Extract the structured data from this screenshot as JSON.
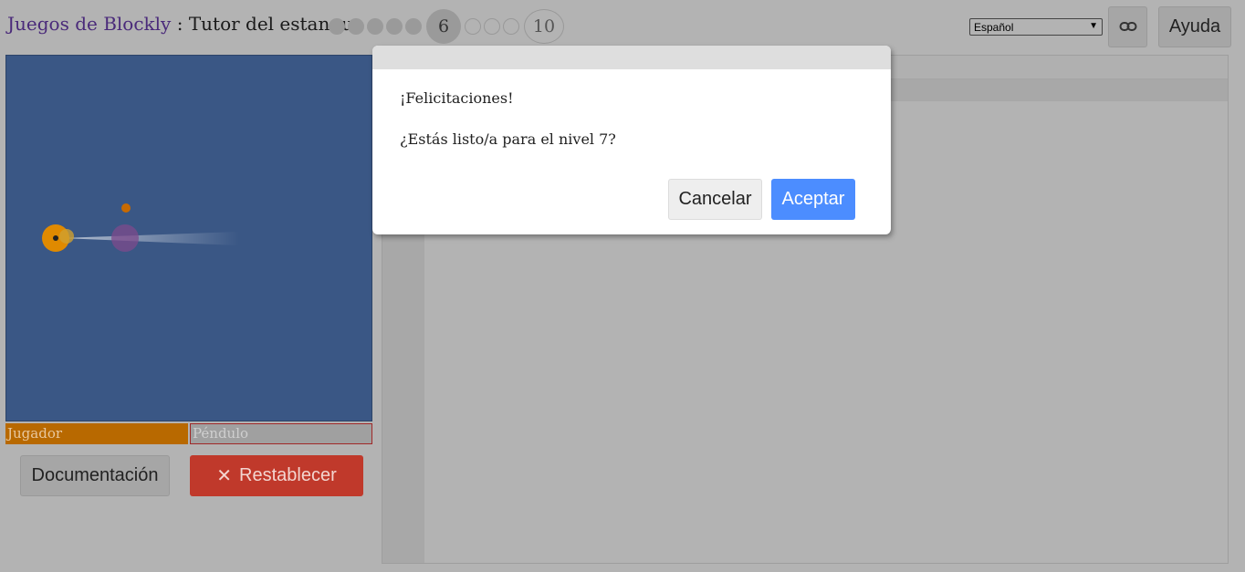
{
  "header": {
    "app_name": "Juegos de Blockly",
    "separator": " : ",
    "game_name": "Tutor del estanque",
    "current_level": "6",
    "last_level": "10",
    "language_selected": "Español",
    "help_label": "Ayuda",
    "link_icon": "link-icon"
  },
  "arena": {
    "player_label": "Jugador",
    "pendulum_label": "Péndulo",
    "player_color": "#b86900",
    "pond_color": "#3a5785"
  },
  "controls": {
    "doc_label": "Documentación",
    "reset_icon": "✕",
    "reset_label": "Restablecer"
  },
  "dialog": {
    "message1": "¡Felicitaciones!",
    "message2": "¿Estás listo/a para el nivel 7?",
    "cancel_label": "Cancelar",
    "ok_label": "Aceptar"
  }
}
